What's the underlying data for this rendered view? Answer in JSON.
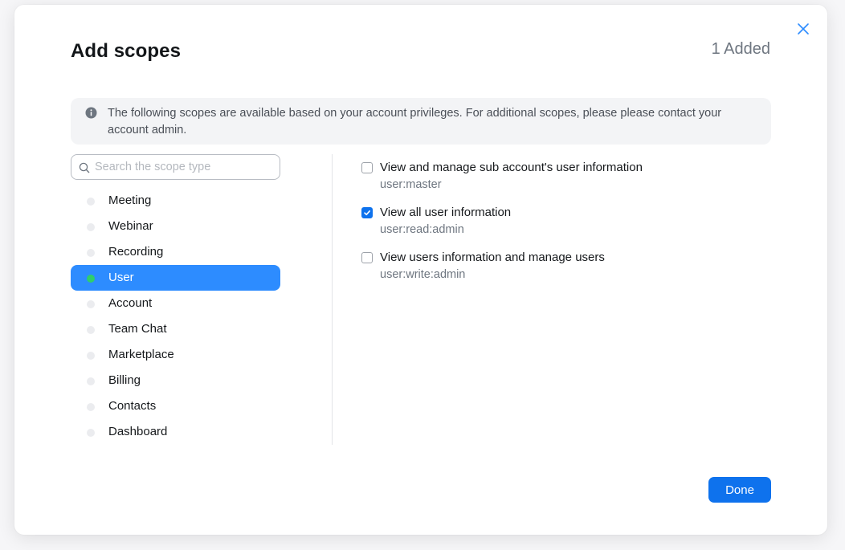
{
  "dialog": {
    "title": "Add scopes",
    "added_count": "1 Added",
    "close_icon": "close-icon",
    "info_icon": "info-icon",
    "info_text": "The following scopes are available based on your account privileges. For additional scopes, please please contact your account admin."
  },
  "search": {
    "placeholder": "Search the scope type",
    "value": "",
    "icon": "search-icon"
  },
  "categories": [
    {
      "label": "Meeting",
      "active": false
    },
    {
      "label": "Webinar",
      "active": false
    },
    {
      "label": "Recording",
      "active": false
    },
    {
      "label": "User",
      "active": true
    },
    {
      "label": "Account",
      "active": false
    },
    {
      "label": "Team Chat",
      "active": false
    },
    {
      "label": "Marketplace",
      "active": false
    },
    {
      "label": "Billing",
      "active": false
    },
    {
      "label": "Contacts",
      "active": false
    },
    {
      "label": "Dashboard",
      "active": false
    }
  ],
  "scopes": [
    {
      "name": "View and manage sub account's user information",
      "code": "user:master",
      "checked": false
    },
    {
      "name": "View all user information",
      "code": "user:read:admin",
      "checked": true
    },
    {
      "name": "View users information and manage users",
      "code": "user:write:admin",
      "checked": false
    }
  ],
  "footer": {
    "done_label": "Done"
  },
  "colors": {
    "accent": "#0e72ed",
    "active_item": "#2d8cff",
    "active_dot": "#2fce6b",
    "banner_bg": "#f3f4f6"
  }
}
